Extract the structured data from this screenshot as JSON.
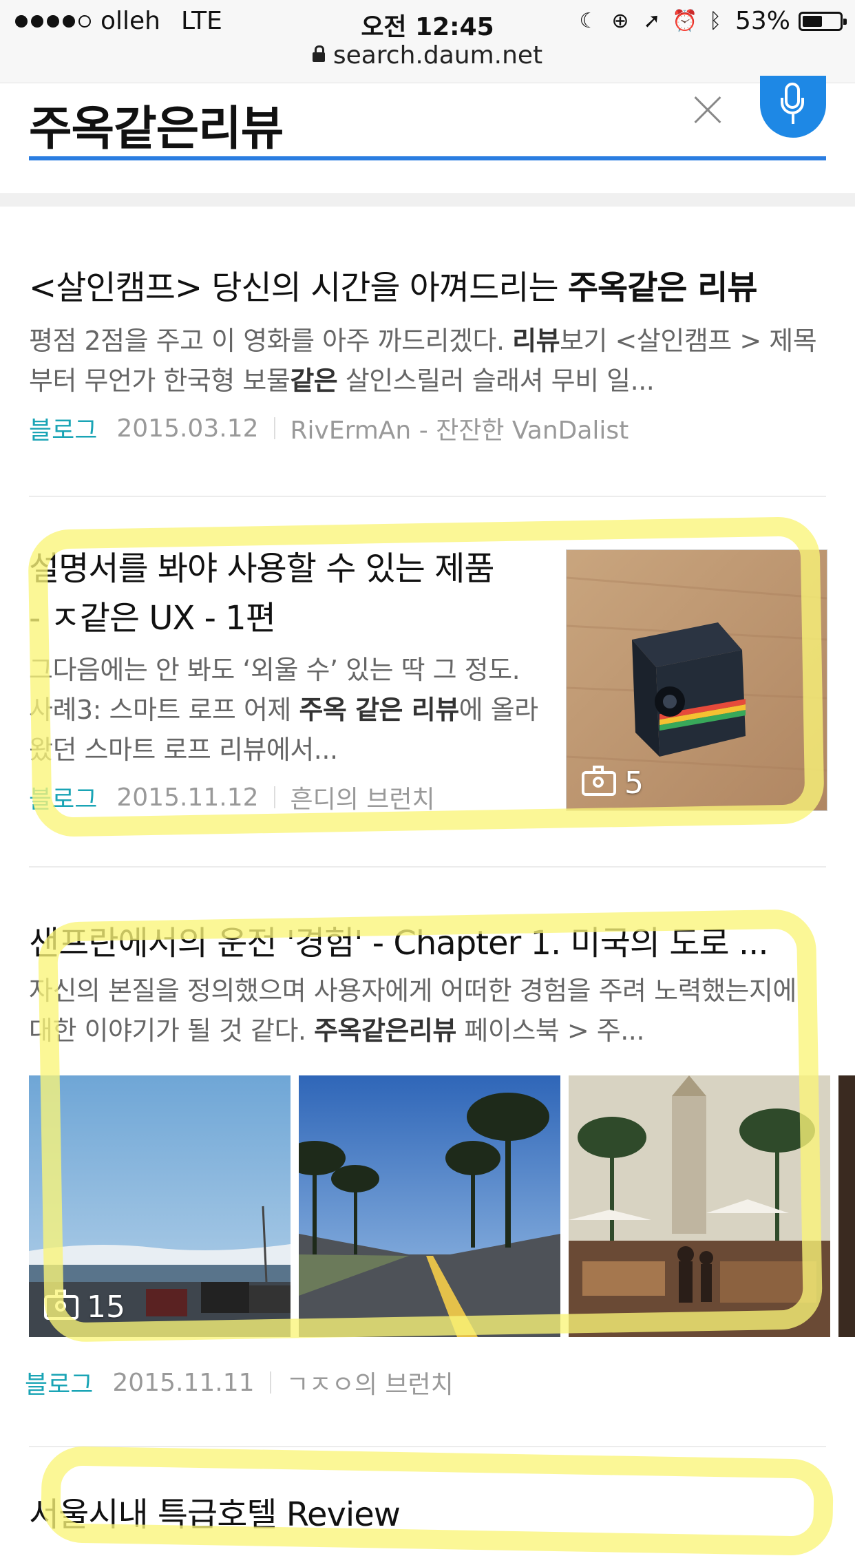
{
  "status_bar": {
    "carrier": "olleh",
    "network": "LTE",
    "time": "오전 12:45",
    "battery": "53%",
    "battery_level": 0.53,
    "icons": [
      "moon-icon",
      "rotation-lock-icon",
      "location-icon",
      "alarm-icon",
      "bluetooth-icon"
    ]
  },
  "address_bar": {
    "url": "search.daum.net"
  },
  "search": {
    "query": "주옥같은리뷰"
  },
  "results": [
    {
      "title_pre": "<살인캠프> 당신의 시간을 아껴드리는 ",
      "title_bold": "주옥같은 리뷰",
      "snippet_1": "평점 2점을 주고 이 영화를 아주 까드리겠다. ",
      "snippet_b1": "리뷰",
      "snippet_2": "보기 <살인캠프 > 제목부터 무언가 한국형 보물",
      "snippet_b2": "같은",
      "snippet_3": " 살인스릴러 슬래셔 무비 일...",
      "source": "블로그",
      "date": "2015.03.12",
      "author": "RivErmAn - 잔잔한 VanDalist"
    },
    {
      "title_line1": "설명서를 봐야 사용할 수 있는 제품",
      "title_line2": "- ㅈ같은 UX - 1편",
      "snippet_1": "그다음에는 안 봐도 ‘외울 수’ 있는 딱 그 정도. 사례3: 스마트 로프 어제 ",
      "snippet_b1": "주옥 같은 리뷰",
      "snippet_2": "에 올라왔던 스마트 로프 리뷰에서...",
      "source": "블로그",
      "date": "2015.11.12",
      "author": "흔디의 브런치",
      "photo_count": "5"
    },
    {
      "title": "샌프란에서의 운전 '경험' - Chapter 1. 미국의 도로 ...",
      "snippet_1": "자신의 본질을 정의했으며 사용자에게 어떠한 경험을 주려 노력했는지에 대한 이야기가 될 것 같다. ",
      "snippet_b1": "주옥같은리뷰",
      "snippet_2": " 페이스북 > 주...",
      "source": "블로그",
      "date": "2015.11.11",
      "author": "ㄱㅈㅇ의 브런치",
      "photo_count": "15"
    },
    {
      "title_partial": "서울시내 특급호텔 Review"
    }
  ],
  "colors": {
    "accent": "#2a7de1",
    "mic_button": "#1e88e5",
    "source_label": "#19a4b5",
    "highlight": "#f7f078"
  }
}
